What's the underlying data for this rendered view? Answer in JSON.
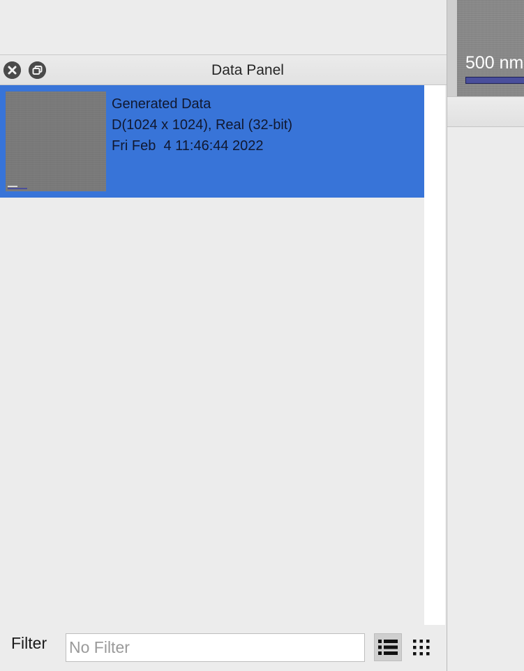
{
  "panel": {
    "title": "Data Panel",
    "close_icon": "close-circle-icon",
    "float_icon": "float-window-icon"
  },
  "list": {
    "items": [
      {
        "name": "Generated Data",
        "dimensions": "D(1024 x 1024), Real (32-bit)",
        "timestamp": "Fri Feb  4 11:46:44 2022",
        "selected": true
      }
    ]
  },
  "footer": {
    "filter_label": "Filter",
    "filter_placeholder": "No Filter",
    "filter_value": "",
    "list_view_icon": "list-view-icon",
    "grid_view_icon": "grid-view-icon"
  },
  "viewer": {
    "scale_label": "500 nm"
  },
  "colors": {
    "selection": "#3874d8",
    "background": "#ececec",
    "scale_bar": "#4a4f9c"
  }
}
